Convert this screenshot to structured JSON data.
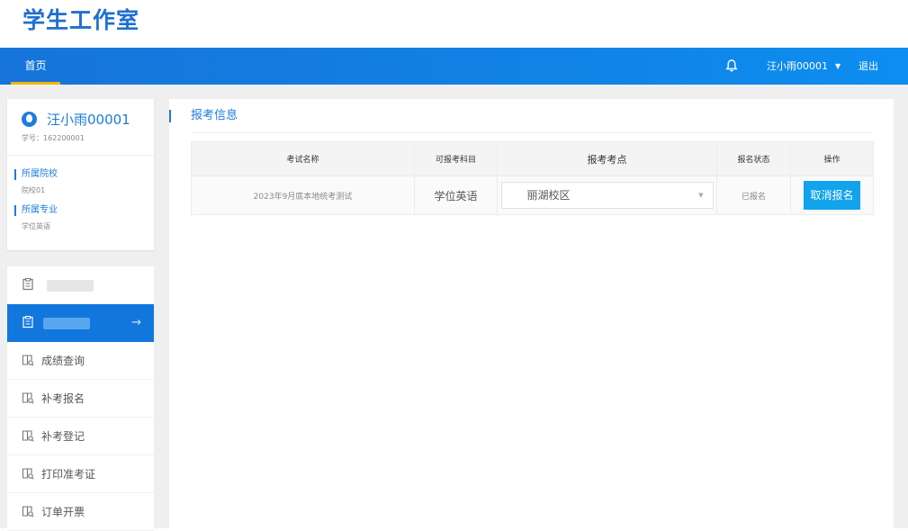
{
  "site_title": "学生工作室",
  "nav": {
    "home": "首页",
    "user": "汪小雨00001",
    "logout": "退出"
  },
  "profile": {
    "name": "汪小雨00001",
    "student_id": "学号：162200001",
    "school_label": "所属院校",
    "school_value": "院校01",
    "major_label": "所属专业",
    "major_value": "学位英语"
  },
  "menu": {
    "items": [
      {
        "label": "成绩查询"
      },
      {
        "label": "补考报名"
      },
      {
        "label": "补考登记"
      },
      {
        "label": "打印准考证"
      },
      {
        "label": "订单开票"
      }
    ]
  },
  "main": {
    "section_title": "报考信息",
    "columns": [
      "考试名称",
      "可报考科目",
      "报考考点",
      "报名状态",
      "操作"
    ],
    "rows": [
      {
        "exam_name": "2023年9月底本地统考测试",
        "subject": "学位英语",
        "site": "丽湖校区",
        "status": "已报名",
        "action": "取消报名"
      }
    ]
  },
  "colors": {
    "brand": "#1e7be0",
    "navbar": "#1182e6",
    "button": "#11a3ec",
    "active_tab_underline": "#f5b400"
  }
}
